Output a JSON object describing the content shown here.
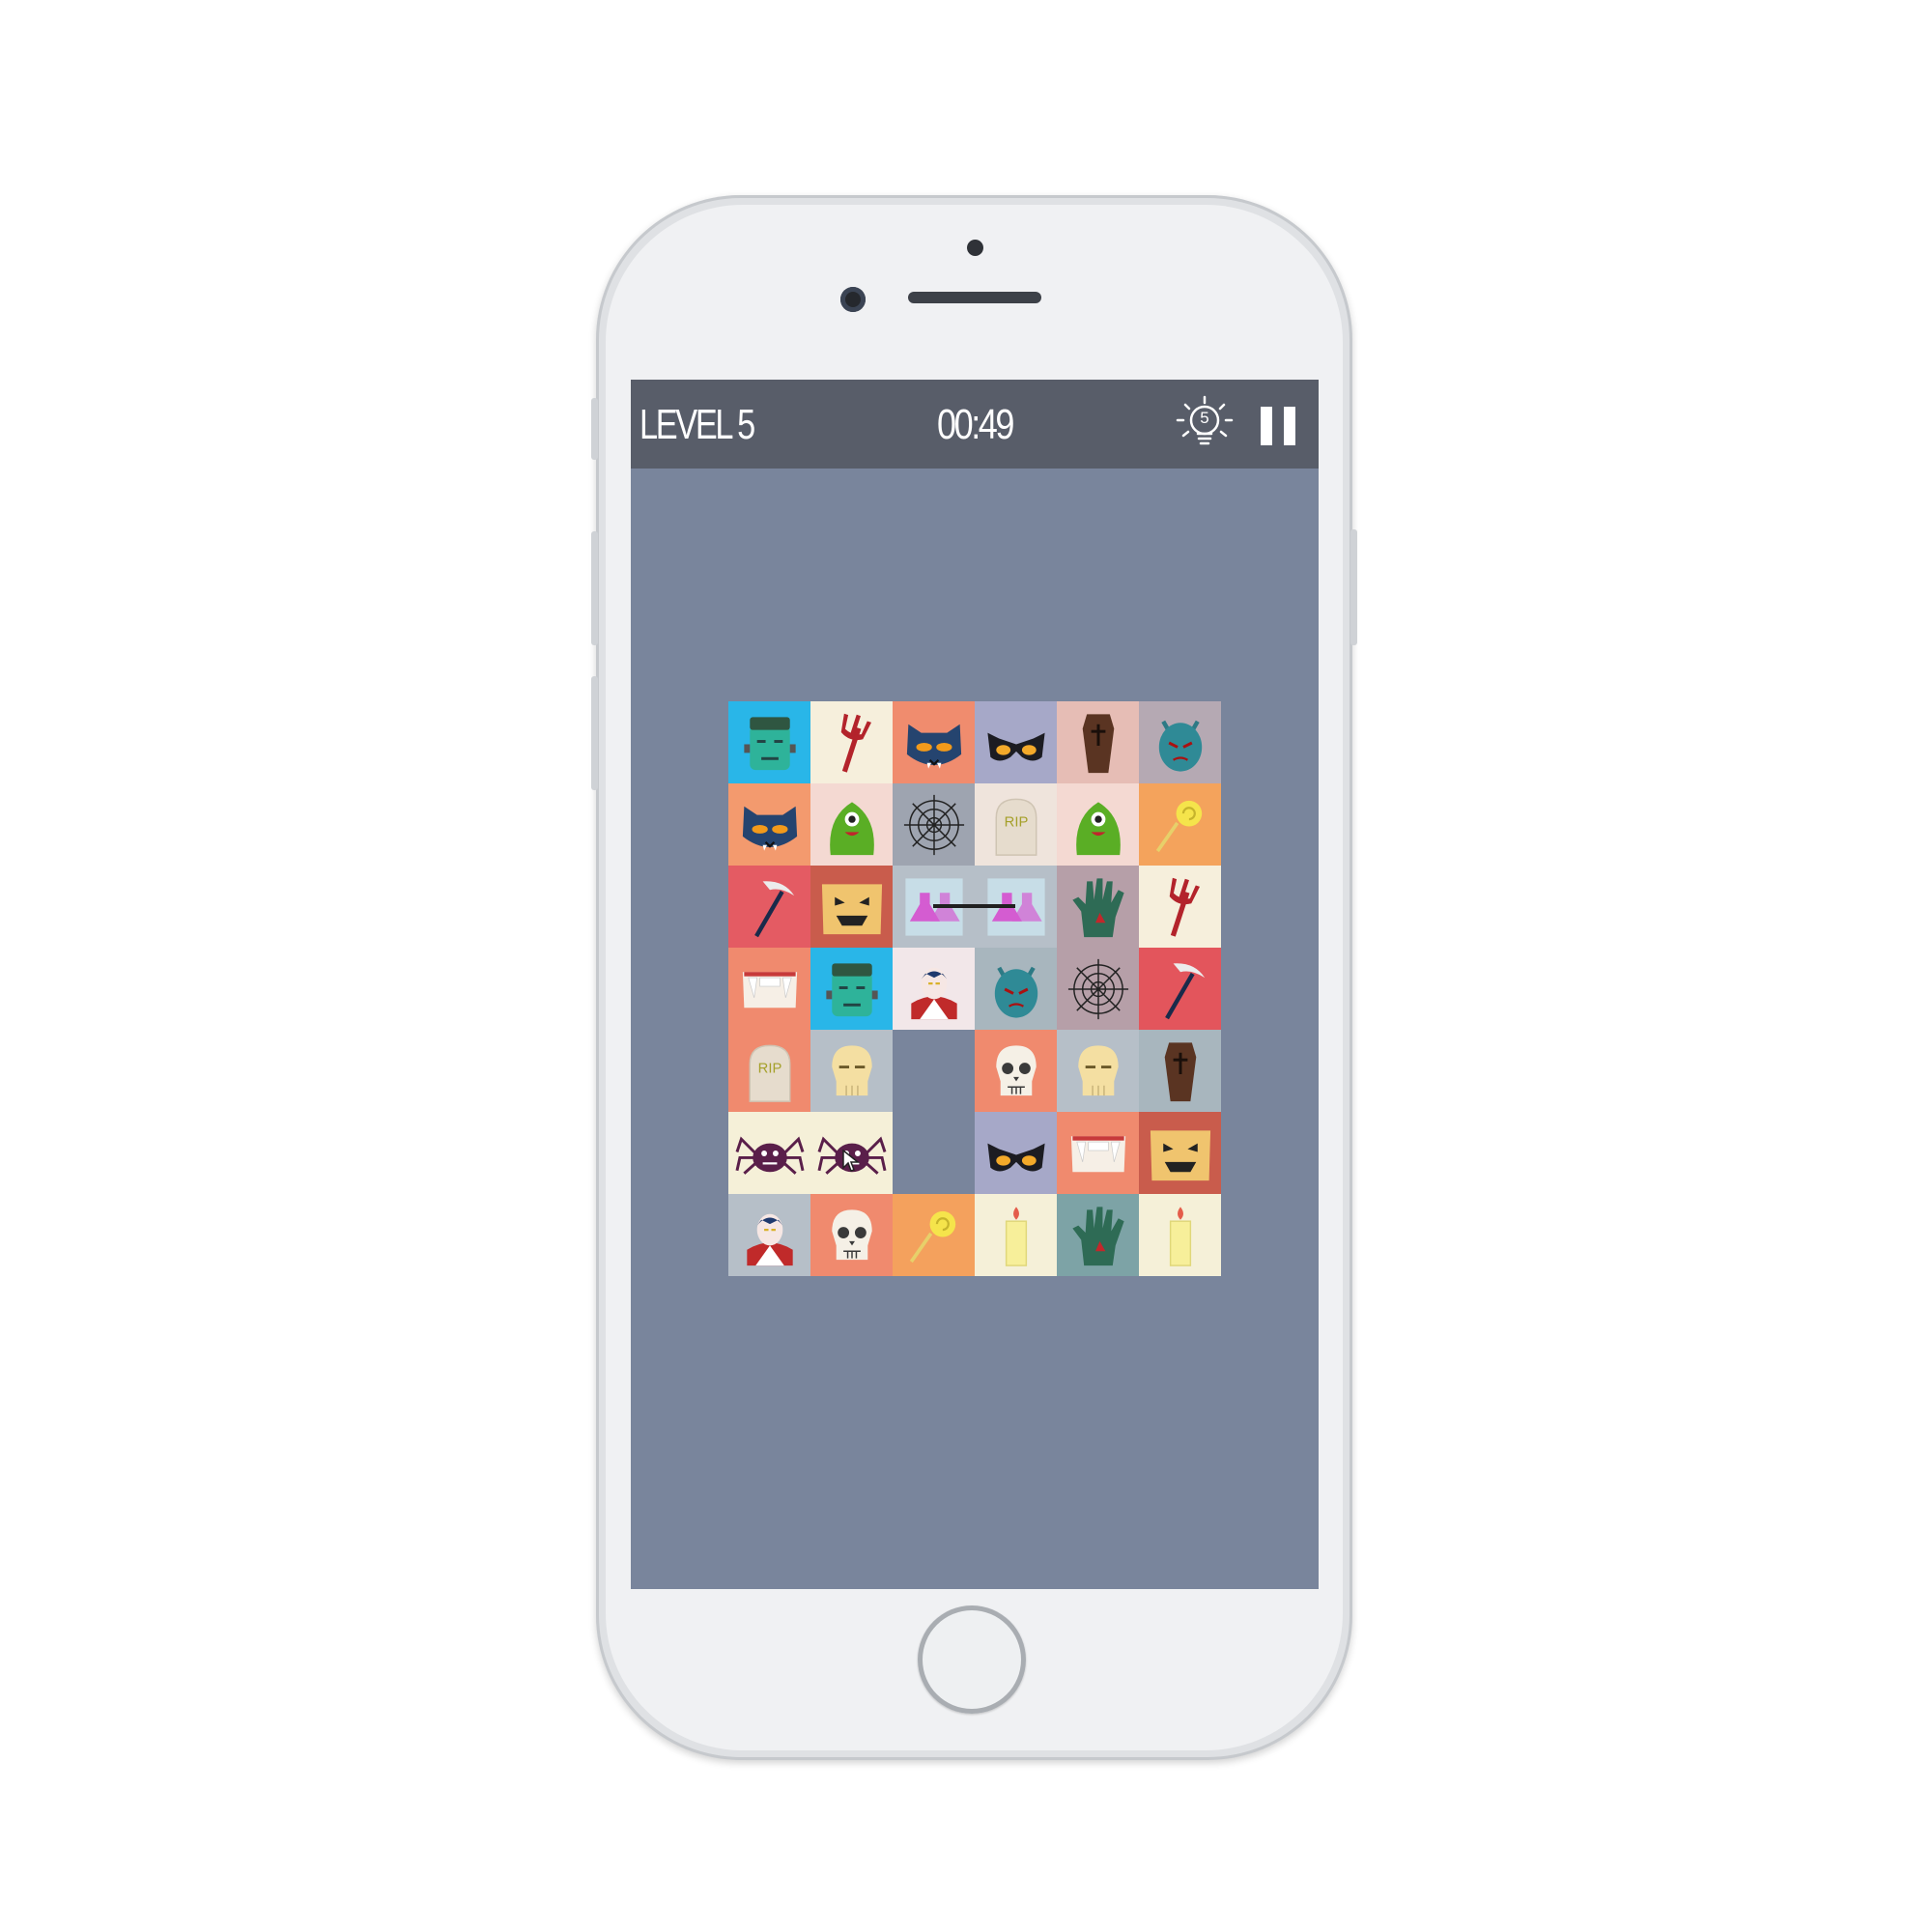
{
  "game": {
    "level_label": "LEVEL 5",
    "timer": "00:49",
    "hints_remaining": "5"
  },
  "colors": {
    "board_bg": "#79859c",
    "topbar_bg": "#585d69",
    "tile_backgrounds": [
      "#29b6e8",
      "#f6efdc",
      "#f08c6e",
      "#a6a8c8",
      "#e6bdb5",
      "#b5a9b3",
      "#f39a6e",
      "#f4d9d2",
      "#9ea4b0",
      "#efe4dc",
      "#f4a35c",
      "#e45b63",
      "#c95c4c",
      "#b6bfc8",
      "#b69fa8",
      "#a8b6be",
      "#e3555c",
      "#f08a6e",
      "#f2e7e9",
      "#7da3a6",
      "#f4a15d",
      "#f5f0d8",
      "#e4585f"
    ]
  },
  "board": {
    "rows": 7,
    "cols": 6,
    "tiles": [
      {
        "icon": "frankenstein-icon",
        "bg": "#29b6e8"
      },
      {
        "icon": "trident-icon",
        "bg": "#f6efdc"
      },
      {
        "icon": "cat-icon",
        "bg": "#f08c6e"
      },
      {
        "icon": "bat-mask-icon",
        "bg": "#a6a8c8"
      },
      {
        "icon": "coffin-icon",
        "bg": "#e6bdb5"
      },
      {
        "icon": "devil-head-icon",
        "bg": "#b5a9b3"
      },
      {
        "icon": "cat-icon",
        "bg": "#f39a6e"
      },
      {
        "icon": "cyclops-icon",
        "bg": "#f4d9d2"
      },
      {
        "icon": "spider-web-icon",
        "bg": "#9ea4b0"
      },
      {
        "icon": "tombstone-icon",
        "bg": "#efe4dc",
        "text": "RIP"
      },
      {
        "icon": "cyclops-icon",
        "bg": "#f4d9d2"
      },
      {
        "icon": "lollipop-icon",
        "bg": "#f4a35c"
      },
      {
        "icon": "scythe-icon",
        "bg": "#e45b63"
      },
      {
        "icon": "pumpkin-icon",
        "bg": "#c95c4c"
      },
      {
        "icon": "potion-icon",
        "bg": "#b6bfc8",
        "state": "matched"
      },
      {
        "icon": "potion-icon",
        "bg": "#b6bfc8",
        "state": "matched"
      },
      {
        "icon": "zombie-hand-icon",
        "bg": "#b69fa8"
      },
      {
        "icon": "trident-icon",
        "bg": "#f6efdc"
      },
      {
        "icon": "fangs-icon",
        "bg": "#f08a6e"
      },
      {
        "icon": "frankenstein-icon",
        "bg": "#29b6e8"
      },
      {
        "icon": "dracula-icon",
        "bg": "#f2e7e9"
      },
      {
        "icon": "devil-head-icon",
        "bg": "#a8b6be"
      },
      {
        "icon": "spider-web-icon",
        "bg": "#b69fa8"
      },
      {
        "icon": "scythe-icon",
        "bg": "#e3555c"
      },
      {
        "icon": "tombstone-icon",
        "bg": "#f08a6e",
        "text": "RIP"
      },
      {
        "icon": "skull-yellow-icon",
        "bg": "#b6bfc8"
      },
      {
        "icon": "empty",
        "bg": ""
      },
      {
        "icon": "skull-white-icon",
        "bg": "#f08a6e"
      },
      {
        "icon": "skull-yellow-icon",
        "bg": "#b6bfc8"
      },
      {
        "icon": "coffin-icon",
        "bg": "#a8b6be"
      },
      {
        "icon": "spider-icon",
        "bg": "#f5f0d8"
      },
      {
        "icon": "spider-icon",
        "bg": "#f5f0d8"
      },
      {
        "icon": "empty",
        "bg": ""
      },
      {
        "icon": "bat-mask-icon",
        "bg": "#a6a8c8"
      },
      {
        "icon": "fangs-icon",
        "bg": "#f08a6e"
      },
      {
        "icon": "pumpkin-icon",
        "bg": "#c95c4c"
      },
      {
        "icon": "dracula-icon",
        "bg": "#b6bfc8"
      },
      {
        "icon": "skull-white-icon",
        "bg": "#f08a6e"
      },
      {
        "icon": "lollipop-icon",
        "bg": "#f4a15d"
      },
      {
        "icon": "candle-icon",
        "bg": "#f5f0d8"
      },
      {
        "icon": "zombie-hand-icon",
        "bg": "#7da3a6"
      },
      {
        "icon": "candle-icon",
        "bg": "#f5f0d8"
      }
    ]
  }
}
